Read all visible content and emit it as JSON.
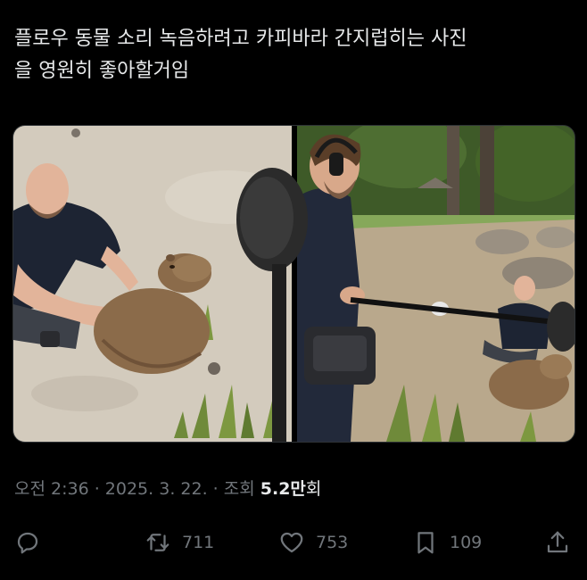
{
  "tweet": {
    "text_line1": "플로우 동물 소리 녹음하려고 카피바라 간지럽히는 사진",
    "text_line2": "을 영원히 좋아할거임"
  },
  "media": {
    "left_photo_alt": "bald man in dark t-shirt petting a capybara on a sandy enclosure floor",
    "right_photo_alt": "sound recordist with headphones holding a boom microphone toward the man and capybara"
  },
  "meta": {
    "time": "오전 2:36",
    "separator1": " · ",
    "date": "2025. 3. 22.",
    "separator2": " · ",
    "views_label": "조회 ",
    "views_count": "5.2만",
    "views_unit": "회"
  },
  "actions": {
    "reply_count": "",
    "retweet_count": "711",
    "like_count": "753",
    "bookmark_count": "109"
  },
  "colors": {
    "background": "#000000",
    "text_primary": "#e7e9ea",
    "text_secondary": "#71767b",
    "border": "#2f3336"
  },
  "icons": [
    "reply-icon",
    "retweet-icon",
    "like-icon",
    "bookmark-icon",
    "share-icon"
  ]
}
